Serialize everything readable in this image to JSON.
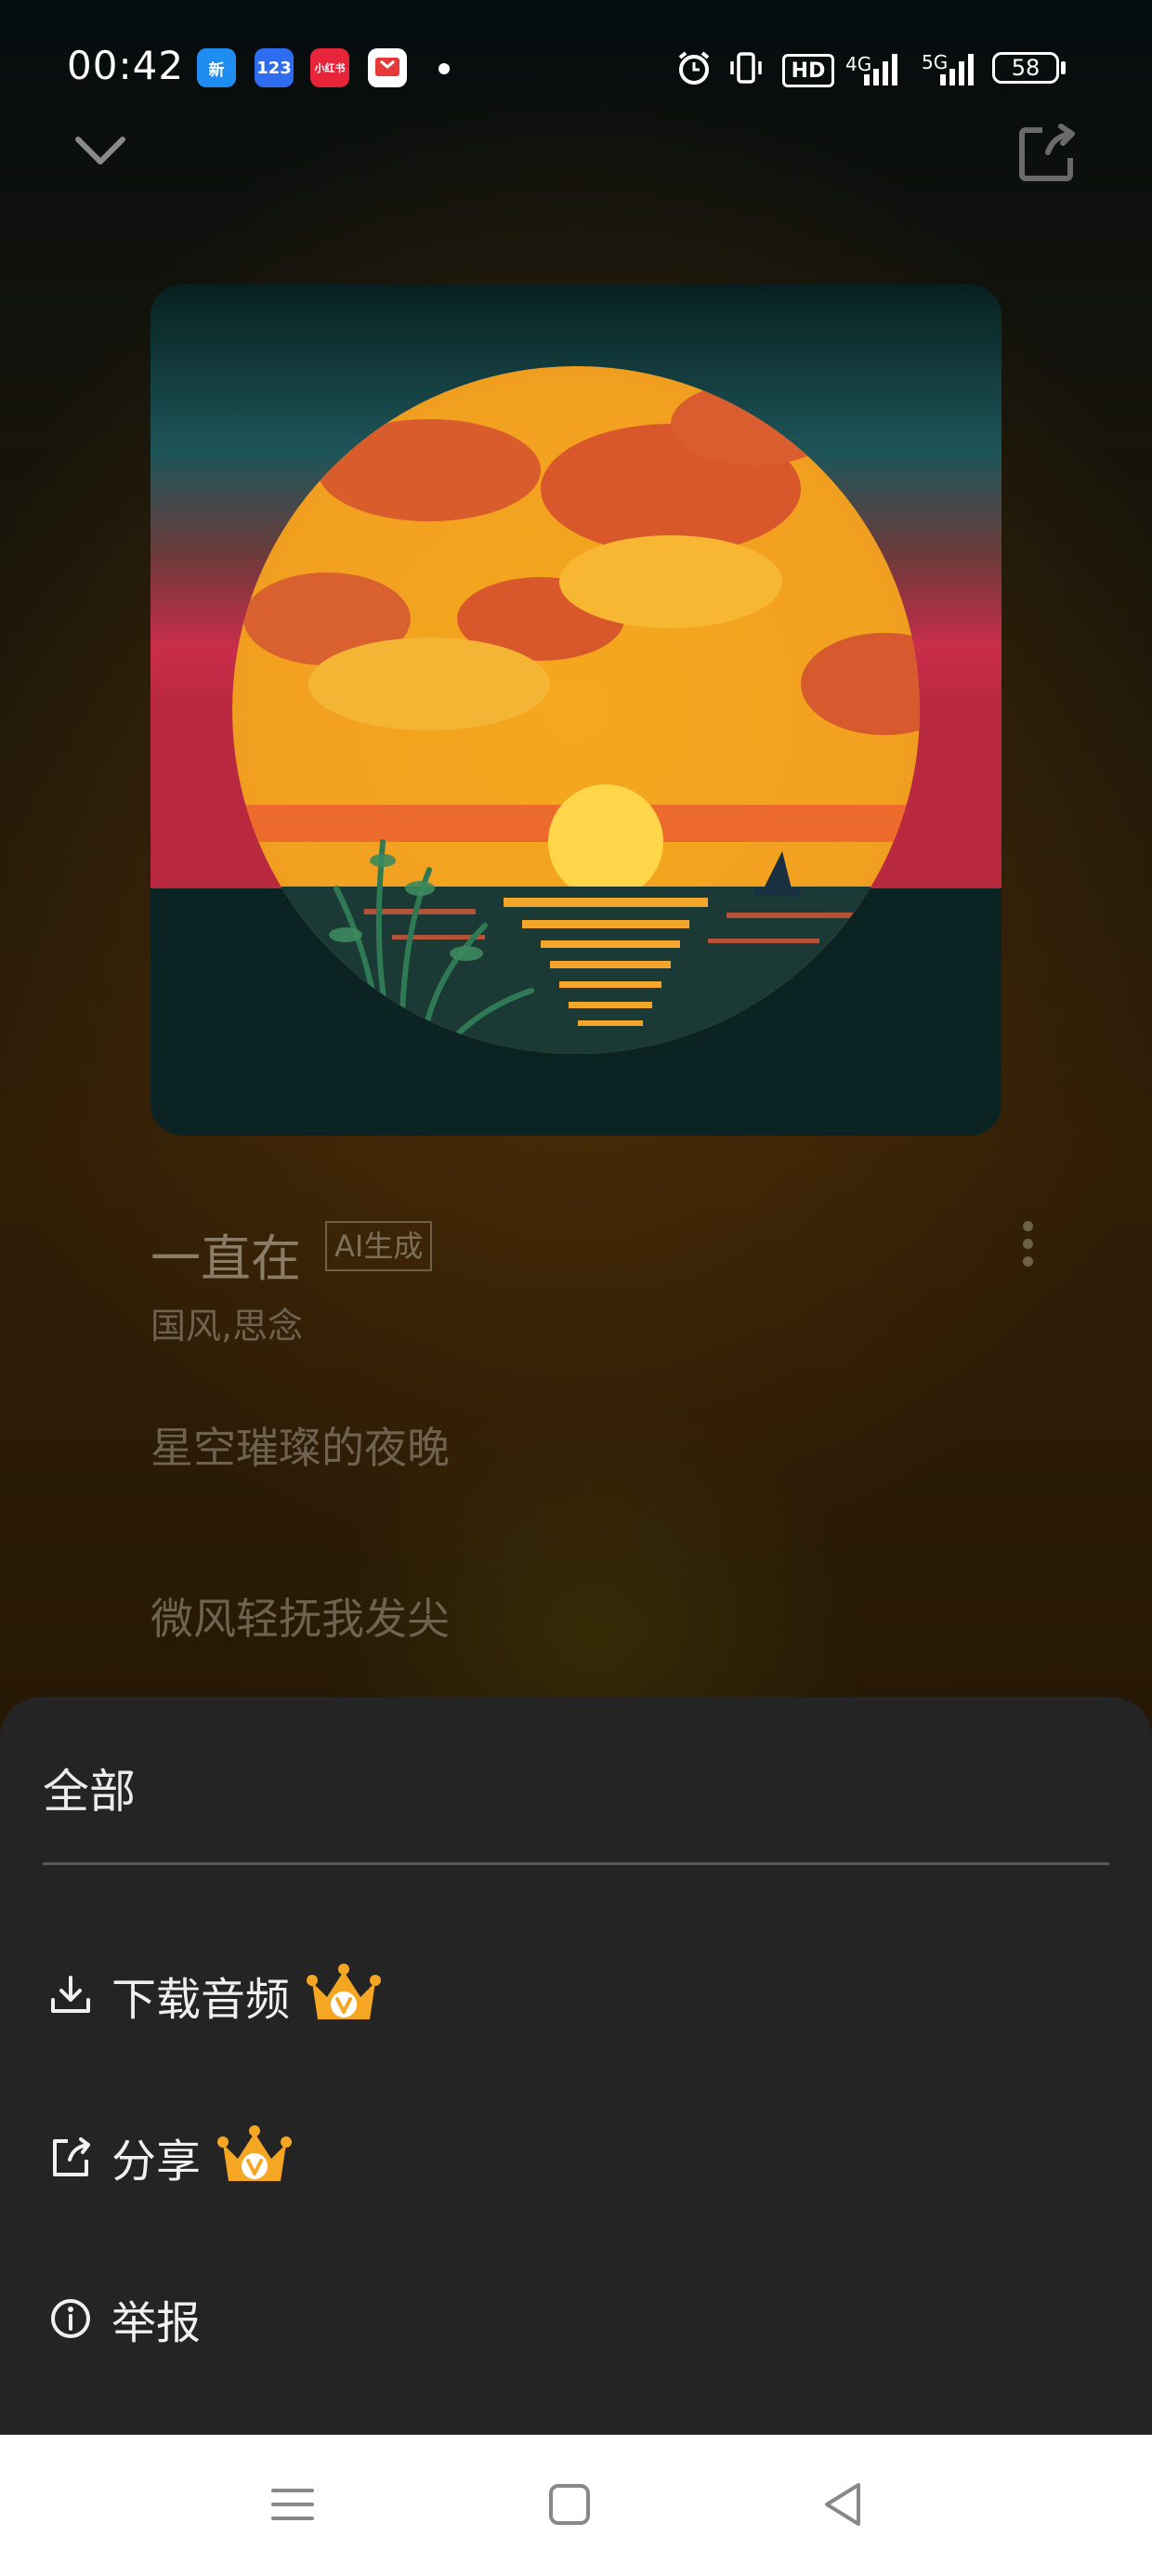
{
  "status_bar": {
    "time": "00:42",
    "apps": [
      {
        "name": "bubble-app-icon",
        "text": "新",
        "color": "#1e8cf0"
      },
      {
        "name": "app-123-icon",
        "text": "123",
        "color": "#2f6df0"
      },
      {
        "name": "xiaohongshu-icon",
        "text": "小红书",
        "color": "#e8243a"
      },
      {
        "name": "reader-app-icon",
        "text": "",
        "color": "#e43a3a"
      }
    ],
    "network_1": "4G",
    "network_2": "5G",
    "hd": "HD",
    "battery": "58"
  },
  "song": {
    "title": "一直在",
    "ai_tag": "AI生成",
    "tags": "国风,思念",
    "lyrics": [
      "星空璀璨的夜晚",
      "微风轻抚我发尖"
    ]
  },
  "sheet": {
    "title": "全部",
    "items": [
      {
        "label": "下载音频",
        "icon": "download-icon",
        "vip": true
      },
      {
        "label": "分享",
        "icon": "share-icon",
        "vip": true
      },
      {
        "label": "举报",
        "icon": "info-icon",
        "vip": false
      }
    ]
  },
  "colors": {
    "sheet_bg": "#242424",
    "vip_crown": "#f5a623"
  }
}
